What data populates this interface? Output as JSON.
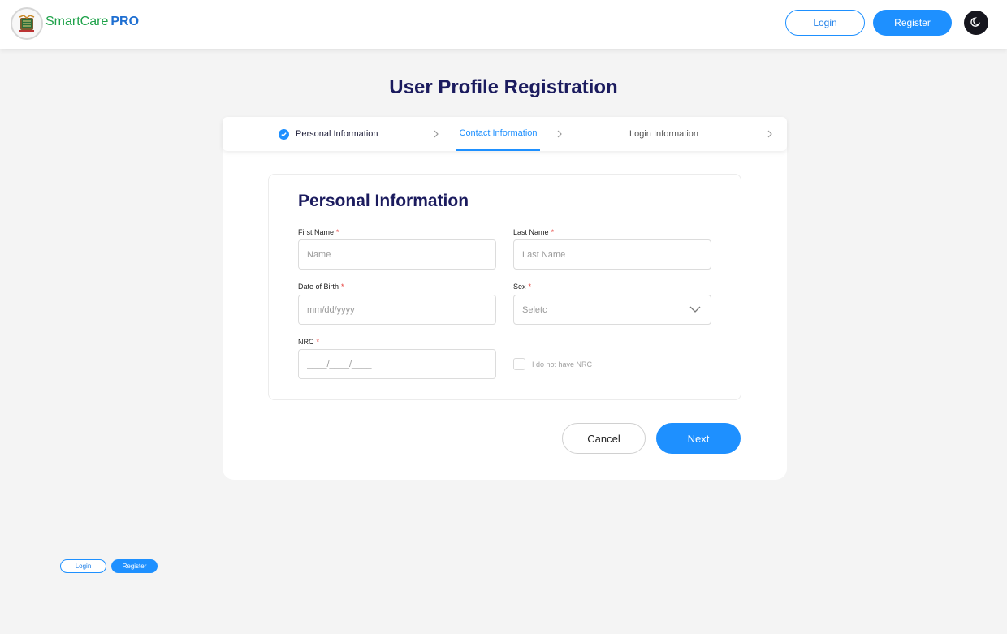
{
  "header": {
    "brand_smart": "SmartCare",
    "brand_pro": "PRO",
    "login_label": "Login",
    "register_label": "Register",
    "theme_icon": "moon-icon",
    "logo_icon": "coat-of-arms-icon"
  },
  "page": {
    "title": "User Profile Registration"
  },
  "stepper": {
    "steps": [
      {
        "label": "Personal Information",
        "status": "completed"
      },
      {
        "label": "Contact Information",
        "status": "active"
      },
      {
        "label": "Login Information",
        "status": "pending"
      }
    ]
  },
  "form": {
    "section_title": "Personal Information",
    "required_marker": "*",
    "fields": {
      "first_name": {
        "label": "First Name",
        "placeholder": "Name"
      },
      "last_name": {
        "label": "Last Name",
        "placeholder": "Last Name"
      },
      "dob": {
        "label": "Date of Birth",
        "placeholder": "mm/dd/yyyy"
      },
      "sex": {
        "label": "Sex",
        "placeholder": "Seletc"
      },
      "nrc": {
        "label": "NRC",
        "placeholder": "____/____/____"
      }
    },
    "no_nrc_label": "I do not have NRC",
    "no_nrc_checked": false
  },
  "actions": {
    "cancel_label": "Cancel",
    "next_label": "Next"
  },
  "footer": {
    "login_label": "Login",
    "register_label": "Register"
  },
  "colors": {
    "accent": "#1e90ff",
    "title": "#1b1b5e",
    "brand_green": "#1fa24a",
    "required": "#e53935"
  }
}
